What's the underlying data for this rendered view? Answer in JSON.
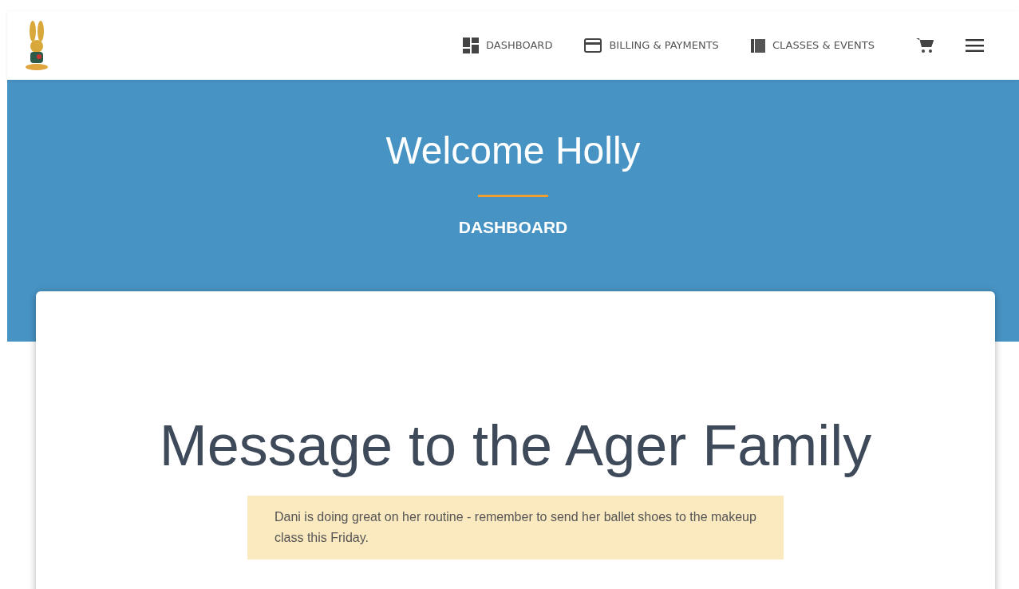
{
  "nav": {
    "items": [
      {
        "label": "DASHBOARD"
      },
      {
        "label": "BILLING & PAYMENTS"
      },
      {
        "label": "CLASSES & EVENTS"
      }
    ]
  },
  "hero": {
    "title": "Welcome Holly",
    "subtitle": "DASHBOARD"
  },
  "message": {
    "title": "Message to the Ager Family",
    "text": "Dani is doing great on her routine - remember to send her ballet shoes to the makeup class this Friday."
  }
}
